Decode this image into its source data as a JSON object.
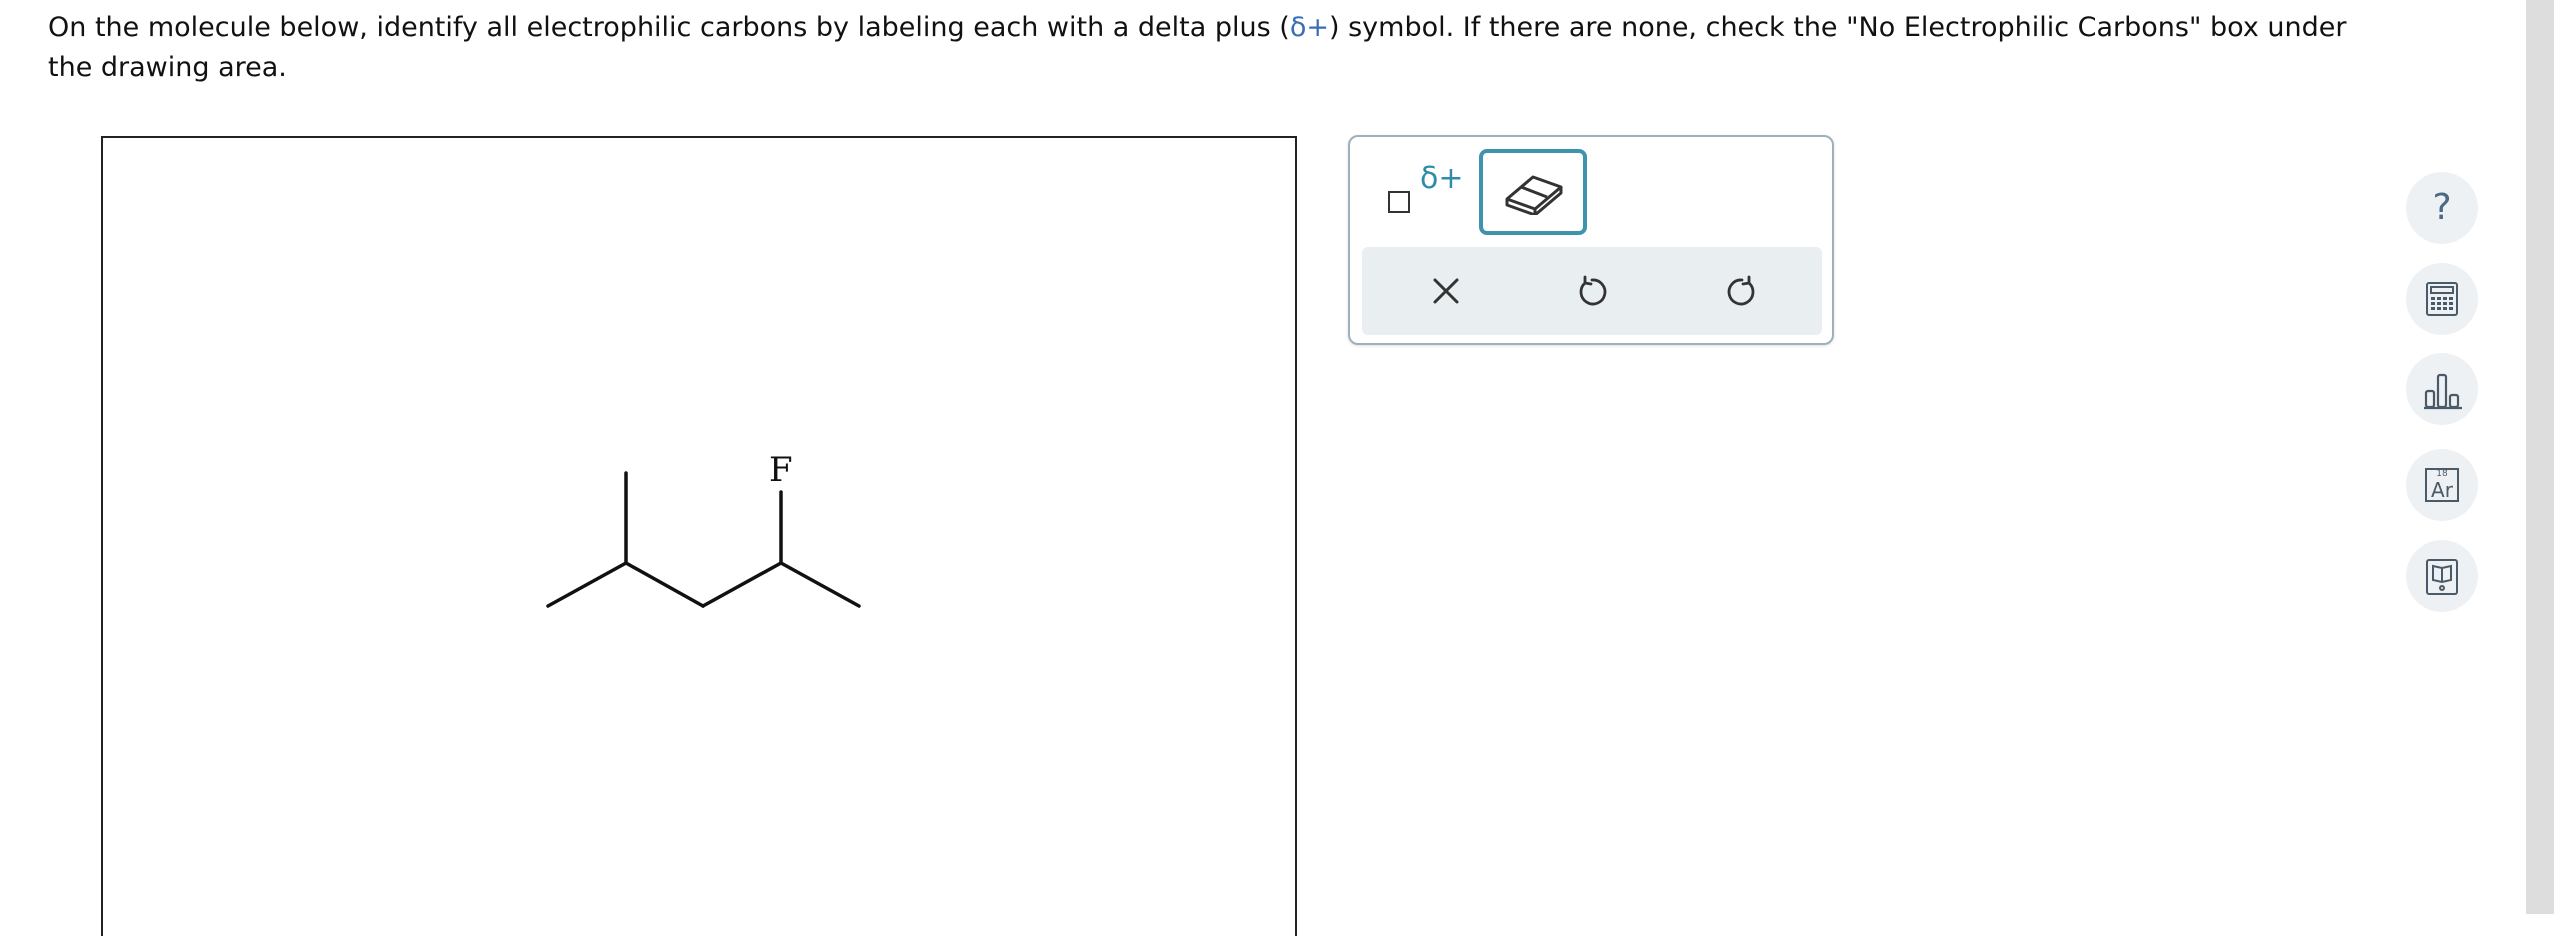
{
  "prompt": {
    "part1": "On the molecule below, identify all electrophilic carbons by labeling each with a delta plus (",
    "delta_symbol": "δ+",
    "part2": ") symbol. If there are none, check the \"No Electrophilic Carbons\" box under the drawing area."
  },
  "canvas": {
    "atom_label": "F"
  },
  "toolbox": {
    "delta_tool_label": "δ+",
    "accent_color": "#3e93ad"
  },
  "sidebar": {
    "help_label": "?",
    "periodic_label_number": "18",
    "periodic_label_symbol": "Ar"
  }
}
